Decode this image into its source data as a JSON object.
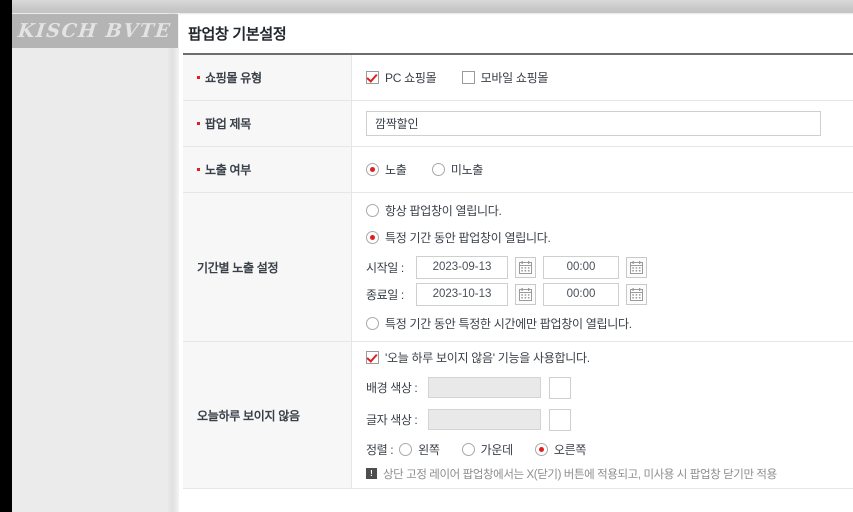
{
  "watermark": {
    "text": "KISCH BVTE"
  },
  "page": {
    "title": "팝업창 기본설정"
  },
  "rows": {
    "shop_type": {
      "label": "쇼핑몰 유형",
      "options": [
        {
          "label": "PC 쇼핑몰",
          "checked": true
        },
        {
          "label": "모바일 쇼핑몰",
          "checked": false
        }
      ]
    },
    "popup_title": {
      "label": "팝업 제목",
      "value": "깜짝할인",
      "placeholder": ""
    },
    "visibility": {
      "label": "노출 여부",
      "options": [
        {
          "label": "노출",
          "checked": true
        },
        {
          "label": "미노출",
          "checked": false
        }
      ]
    },
    "period": {
      "label": "기간별 노출 설정",
      "option_always": "항상 팝업창이 열립니다.",
      "option_range": "특정 기간 동안 팝업창이 열립니다.",
      "option_range_time": "특정 기간 동안 특정한 시간에만 팝업창이 열립니다.",
      "start_label": "시작일 :",
      "start_date": "2023-09-13",
      "start_time": "00:00",
      "end_label": "종료일 :",
      "end_date": "2023-10-13",
      "end_time": "00:00",
      "calendar_icon": "calendar-icon"
    },
    "today_hide": {
      "label_line1": "오늘하루 보이지",
      "label_line2": "않음",
      "use_label": "'오늘 하루 보이지 않음' 기능을 사용합니다.",
      "use_checked": true,
      "bg_color_label": "배경 색상 :",
      "bg_color_value": "",
      "text_color_label": "글자 색상 :",
      "text_color_value": "",
      "align_label": "정렬 :",
      "align_options": [
        {
          "label": "왼쪽",
          "checked": false
        },
        {
          "label": "가운데",
          "checked": false
        },
        {
          "label": "오른쪽",
          "checked": true
        }
      ],
      "note_badge": "!",
      "note_text": "상단 고정 레이어 팝업창에서는 X(닫기) 버튼에 적용되고, 미사용 시 팝업창 닫기만 적용"
    }
  },
  "colors": {
    "accent_red": "#e02020",
    "label_bg": "#f7f7f7",
    "border": "#e6e6e6",
    "text": "#3a4049",
    "note_text": "#8d8d8d"
  }
}
